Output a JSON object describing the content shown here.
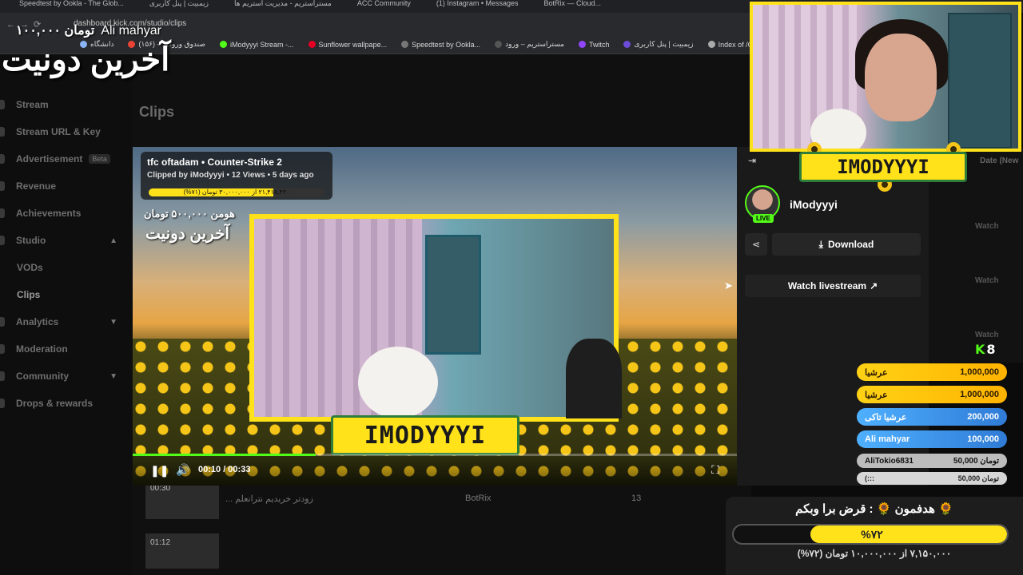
{
  "browser": {
    "tabs": [
      "Speedtest by Ookla - The Glob...",
      "زیمبیت | پنل کاربری",
      "مستراستریم - مدیریت استریم ها",
      "ACC Community",
      "(1) Instagram • Messages",
      "BotRix — Cloud..."
    ],
    "url": "dashboard.kick.com/studio/clips",
    "bookmarks": [
      "دانشگاه",
      "صندوق ورودی – (۱۵۶)",
      "iModyyyi Stream -...",
      "Sunflower wallpape...",
      "Speedtest by Ookla...",
      "مستراستریم – ورود",
      "Twitch",
      "زیمبیت | پنل کاربری",
      "Index of /Online/De..."
    ]
  },
  "overlay": {
    "top_amount": "۱۰۰,۰۰۰ تومان",
    "top_name": "Ali mahyar",
    "last_donate": "آخرین دونیت"
  },
  "sidebar": {
    "items": [
      {
        "label": "Stream",
        "y": 0
      },
      {
        "label": "Stream URL & Key"
      },
      {
        "label": "Advertisement",
        "badge": "Beta"
      },
      {
        "label": "Revenue"
      },
      {
        "label": "Achievements"
      },
      {
        "label": "Studio"
      },
      {
        "label": "VODs"
      },
      {
        "label": "Clips"
      },
      {
        "label": "Analytics"
      },
      {
        "label": "Moderation"
      },
      {
        "label": "Community"
      },
      {
        "label": "Drops & rewards"
      }
    ]
  },
  "main": {
    "title": "Clips",
    "rows": [
      {
        "time": "00:30",
        "title": "... زودتر خریدیم نترانعلم",
        "author": "BotRix",
        "views": "13"
      },
      {
        "time": "01:12",
        "title": "",
        "author": "",
        "views": ""
      }
    ]
  },
  "player": {
    "clip_title": "tfc oftadam • Counter-Strike 2",
    "clip_meta": "Clipped by iModyyyi • 12 Views • 5 days ago",
    "mini_progress_label": "۲۱,۴۱۵,۴۳۰ از ۳۰,۰۰۰,۰۰۰ تومان (۷۱%)",
    "mini_progress": 0.71,
    "overlay_amount": "هومن ۵۰۰,۰۰۰ تومان",
    "overlay_last": "آخرین دونیت",
    "banner": "IMODYYYI",
    "time": "00:10 / 00:33",
    "progress": 0.303
  },
  "panel": {
    "channel": "iModyyyi",
    "live": "LIVE",
    "download": "Download",
    "watch_livestream": "Watch livestream"
  },
  "farcol": {
    "date_header": "Date (New",
    "watch": [
      "Watch",
      "Watch",
      "Watch"
    ]
  },
  "webcam": {
    "banner": "IMODYYYI"
  },
  "leaderboard": [
    {
      "name": "عرشیا",
      "amount": "1,000,000",
      "style": "gold"
    },
    {
      "name": "عرشیا",
      "amount": "1,000,000",
      "style": "gold"
    },
    {
      "name": "عرشیا تاکی",
      "amount": "200,000",
      "style": "blue"
    },
    {
      "name": "Ali mahyar",
      "amount": "100,000",
      "style": "blue"
    },
    {
      "name": "AliTokio6831",
      "amount": "50,000 تومان",
      "style": "gray"
    },
    {
      "name": "(:::",
      "amount": "50,000 تومان",
      "style": "lgray"
    }
  ],
  "goal": {
    "title": "🌻 هدفمون 🌻 : قرض برا وبکم",
    "percent_label": "%۷۲",
    "percent": 0.72,
    "subtitle": "۷,۱۵۰,۰۰۰ از ۱۰,۰۰۰,۰۰۰ تومان (۷۲%)"
  },
  "colors": {
    "kick_green": "#53fc18",
    "overlay_yellow": "#ffe21a"
  }
}
